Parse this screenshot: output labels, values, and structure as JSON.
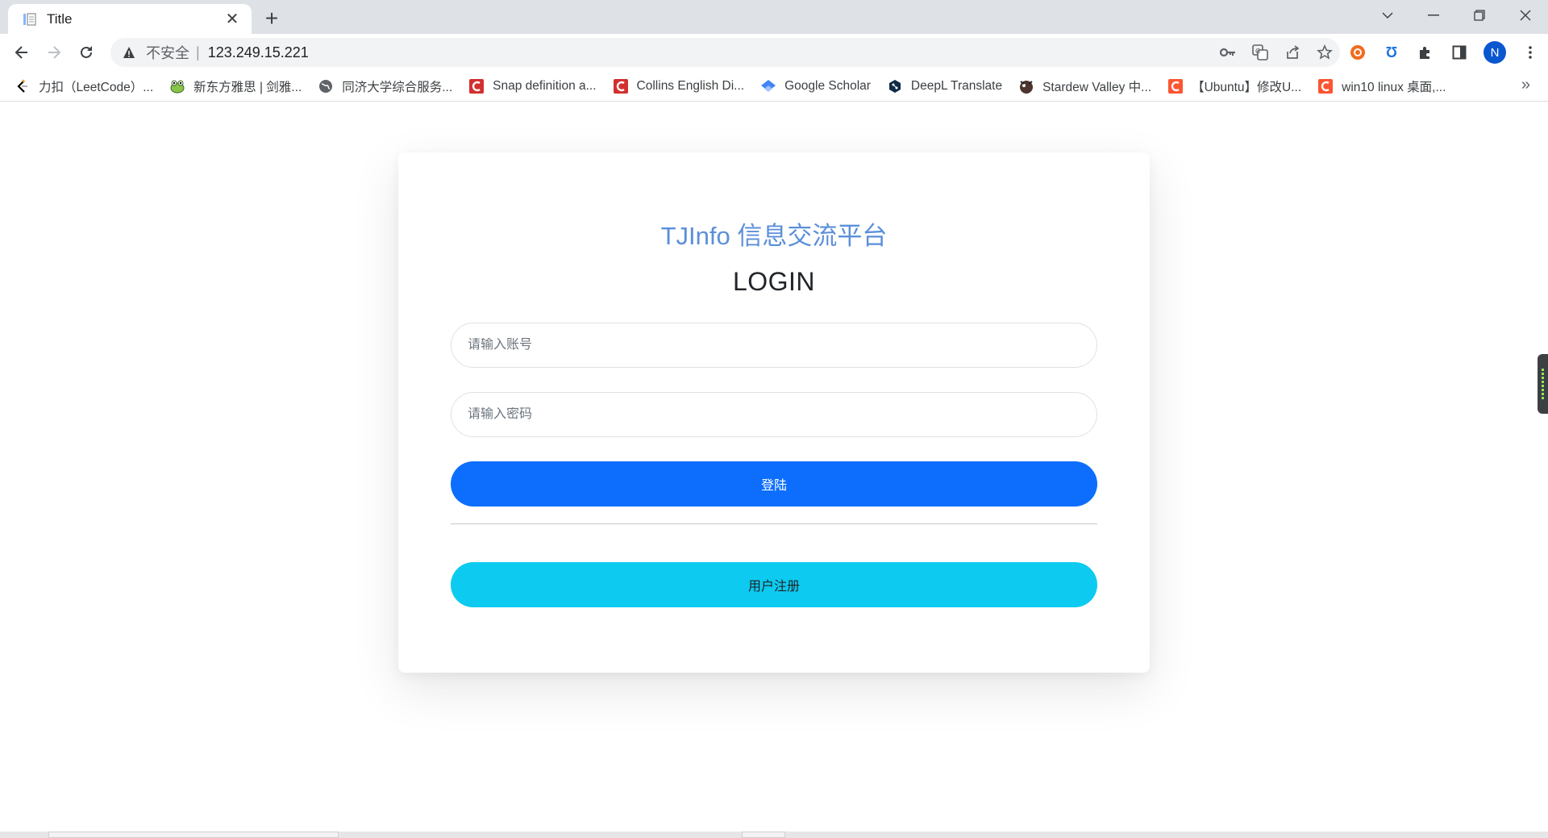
{
  "browser": {
    "tab": {
      "title": "Title"
    },
    "omnibox": {
      "security_label": "不安全",
      "separator": "|",
      "url": "123.249.15.221"
    },
    "profile_initial": "N",
    "bookmarks": [
      {
        "label": "力扣（LeetCode）...",
        "icon": "leetcode-icon"
      },
      {
        "label": "新东方雅思 | 剑雅...",
        "icon": "frog-icon"
      },
      {
        "label": "同济大学综合服务...",
        "icon": "globe-icon"
      },
      {
        "label": "Snap definition a...",
        "icon": "collins-icon"
      },
      {
        "label": "Collins English Di...",
        "icon": "collins-icon"
      },
      {
        "label": "Google Scholar",
        "icon": "scholar-icon"
      },
      {
        "label": "DeepL Translate",
        "icon": "deepl-icon"
      },
      {
        "label": "Stardew Valley 中...",
        "icon": "stardew-icon"
      },
      {
        "label": "【Ubuntu】修改U...",
        "icon": "csdn-icon"
      },
      {
        "label": "win10 linux 桌面,...",
        "icon": "csdn-icon"
      }
    ],
    "bookmarks_more": "»"
  },
  "login": {
    "brand": "TJInfo 信息交流平台",
    "heading": "LOGIN",
    "account_placeholder": "请输入账号",
    "password_placeholder": "请输入密码",
    "login_button": "登陆",
    "register_button": "用户注册"
  },
  "colors": {
    "brand_text": "#5b8fd9",
    "login_button": "#0d6efd",
    "register_button": "#0dcaf0"
  }
}
